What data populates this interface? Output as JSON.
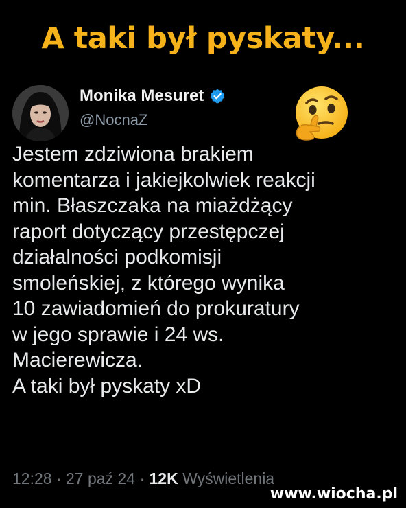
{
  "headline": "A taki był pyskaty...",
  "tweet": {
    "author_name": "Monika Mesuret",
    "author_handle": "@NocnaZ",
    "lines": [
      "Jestem zdziwiona brakiem",
      "komentarza i jakiejkolwiek reakcji",
      "min. Błaszczaka na miażdżący",
      "raport dotyczący przestępczej",
      "działalności podkomisji",
      "smoleńskiej, z którego wynika",
      "10 zawiadomień do prokuratury",
      "w jego sprawie i 24 ws.",
      "Macierewicza.",
      "A taki był pyskaty xD"
    ],
    "time": "12:28",
    "date": "27 paź 24",
    "views_count": "12K",
    "views_label": "Wyświetlenia"
  },
  "emoji": "thinking-face-icon",
  "watermark": "www.wiocha.pl",
  "colors": {
    "headline": "#f5b21b",
    "background": "#000000",
    "verified": "#1d9bf0",
    "secondary_text": "#71767b"
  }
}
